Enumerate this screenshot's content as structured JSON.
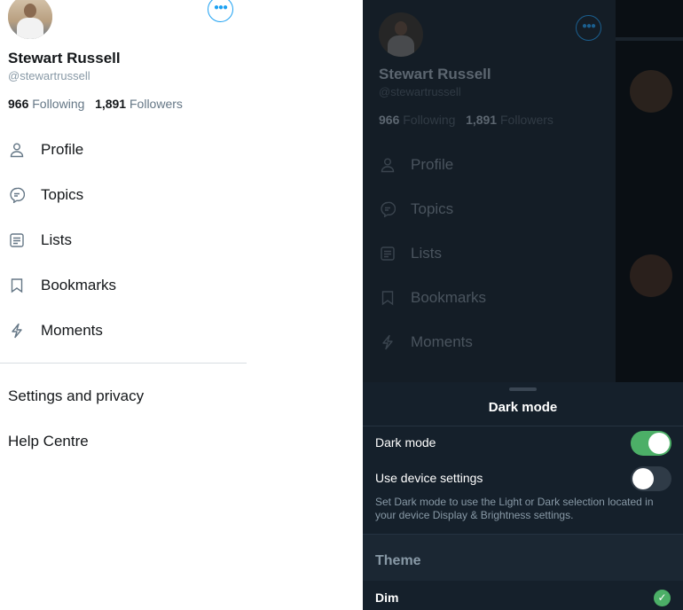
{
  "profile": {
    "name": "Stewart Russell",
    "handle": "@stewartrussell",
    "following_count": "966",
    "following_label": "Following",
    "followers_count": "1,891",
    "followers_label": "Followers"
  },
  "menu": [
    {
      "label": "Profile",
      "icon": "person-icon"
    },
    {
      "label": "Topics",
      "icon": "topics-icon"
    },
    {
      "label": "Lists",
      "icon": "lists-icon"
    },
    {
      "label": "Bookmarks",
      "icon": "bookmark-icon"
    },
    {
      "label": "Moments",
      "icon": "lightning-icon"
    }
  ],
  "footer": {
    "settings": "Settings and privacy",
    "help": "Help Centre"
  },
  "dark_sheet": {
    "title": "Dark mode",
    "dark_mode_label": "Dark mode",
    "dark_mode_on": true,
    "device_settings_label": "Use device settings",
    "device_settings_on": false,
    "description": "Set Dark mode to use the Light or Dark selection located in your device Display & Brightness settings.",
    "theme_heading": "Theme",
    "selected_theme": "Dim"
  },
  "colors": {
    "accent": "#1da1f2",
    "toggle_on": "#4caf67",
    "sheet_bg": "#15202b"
  }
}
